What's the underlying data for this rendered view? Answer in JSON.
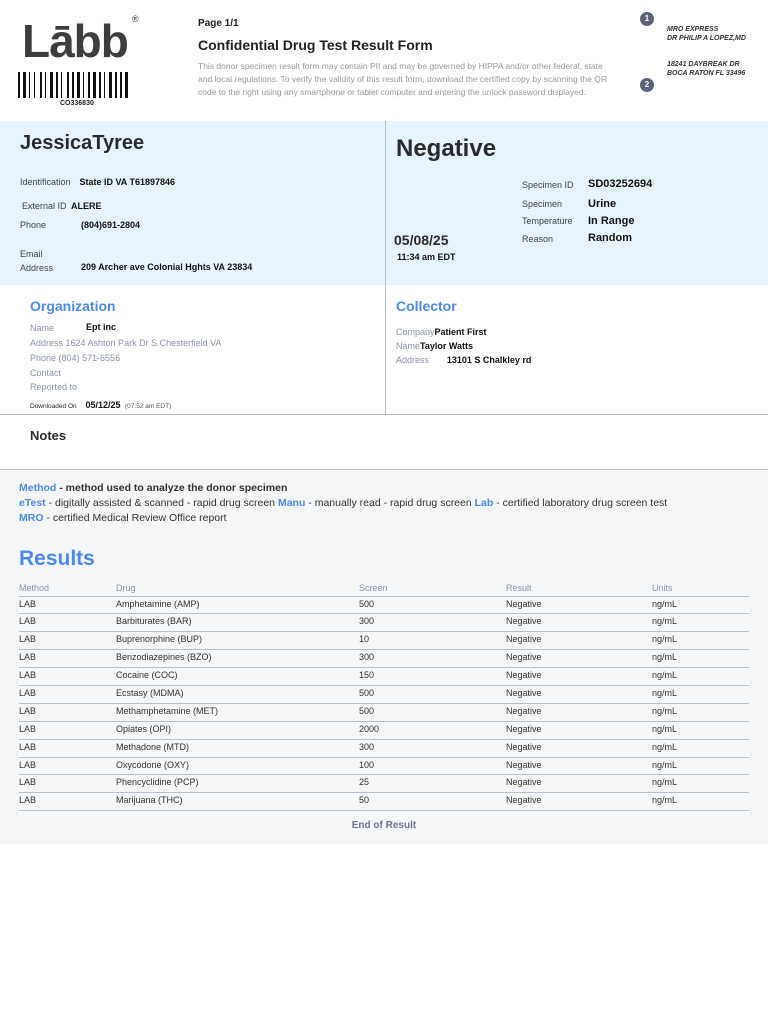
{
  "header": {
    "logo": "Lābb",
    "registered": "®",
    "barcode_number": "CO336830",
    "page": "Page 1/1",
    "title": "Confidential Drug Test Result Form",
    "disclaimer": "This donor specimen result form may contain PII and may be governed by HIPPA and/or other federal, state and local regulations. To verify the validity of this result form, download the certified copy by scanning the QR code to the right using any smartphone or tablet computer and entering the unlock password displayed.",
    "badge1": "1",
    "badge2": "2",
    "mro_line1": "MRO EXPRESS",
    "mro_line2": "DR PHILIP A LOPEZ,MD",
    "addr_line1": "18241 DAYBREAK DR",
    "addr_line2": "BOCA RATON FL 33496"
  },
  "donor": {
    "name": "JessicaTyree",
    "identification_label": "Identification",
    "identification": "State ID VA T61897846",
    "external_label": "External ID",
    "external": "ALERE",
    "phone_label": "Phone",
    "phone": "(804)691-2804",
    "email_label": "Email",
    "address_label": "Address",
    "address": "209 Archer ave Colonial Hghts VA 23834"
  },
  "result": {
    "status": "Negative",
    "date": "05/08/25",
    "time": "11:34 am EDT",
    "specimen_id_label": "Specimen ID",
    "specimen_id": "SD03252694",
    "specimen_label": "Specimen",
    "specimen": "Urine",
    "temperature_label": "Temperature",
    "temperature": "In Range",
    "reason_label": "Reason",
    "reason": "Random"
  },
  "organization": {
    "title": "Organization",
    "name_label": "Name",
    "name": "Ept inc",
    "address": "Address 1624 Ashton Park Dr S.Chesterfield VA",
    "phone": "Phone (804) 571-6556",
    "contact": "Contact",
    "reported": "Reported to",
    "downloaded_label": "Downloaded On",
    "downloaded_date": "05/12/25",
    "downloaded_time": "(07:52 am EDT)"
  },
  "collector": {
    "title": "Collector",
    "company_label": "Company",
    "company": "Patient First",
    "name_label": "Name",
    "name": "Taylor Watts",
    "address_label": "Address",
    "address": "13101 S Chalkley rd"
  },
  "notes": {
    "title": "Notes"
  },
  "legend": {
    "method": "Method",
    "method_desc": " - method used to analyze the donor specimen",
    "etest": "eTest",
    "etest_desc": " - digitally assisted & scanned - rapid drug screen ",
    "manu": "Manu",
    "manu_desc": " - manually read - rapid drug screen ",
    "lab": "Lab",
    "lab_desc": " - certified laboratory drug screen test",
    "mro": "MRO",
    "mro_desc": " - certified Medical Review Office report"
  },
  "results": {
    "title": "Results",
    "columns": [
      "Method",
      "Drug",
      "Screen",
      "Result",
      "Units"
    ],
    "rows": [
      [
        "LAB",
        "Amphetamine (AMP)",
        "500",
        "Negative",
        "ng/mL"
      ],
      [
        "LAB",
        "Barbiturates (BAR)",
        "300",
        "Negative",
        "ng/mL"
      ],
      [
        "LAB",
        "Buprenorphine (BUP)",
        "10",
        "Negative",
        "ng/mL"
      ],
      [
        "LAB",
        "Benzodiazepines (BZO)",
        "300",
        "Negative",
        "ng/mL"
      ],
      [
        "LAB",
        "Cocaine (COC)",
        "150",
        "Negative",
        "ng/mL"
      ],
      [
        "LAB",
        "Ecstasy (MDMA)",
        "500",
        "Negative",
        "ng/mL"
      ],
      [
        "LAB",
        "Methamphetamine (MET)",
        "500",
        "Negative",
        "ng/mL"
      ],
      [
        "LAB",
        "Opiates (OPI)",
        "2000",
        "Negative",
        "ng/mL"
      ],
      [
        "LAB",
        "Methadone (MTD)",
        "300",
        "Negative",
        "ng/mL"
      ],
      [
        "LAB",
        "Oxycodone (OXY)",
        "100",
        "Negative",
        "ng/mL"
      ],
      [
        "LAB",
        "Phencyclidine (PCP)",
        "25",
        "Negative",
        "ng/mL"
      ],
      [
        "LAB",
        "Marijuana (THC)",
        "50",
        "Negative",
        "ng/mL"
      ]
    ],
    "end": "End of Result"
  }
}
